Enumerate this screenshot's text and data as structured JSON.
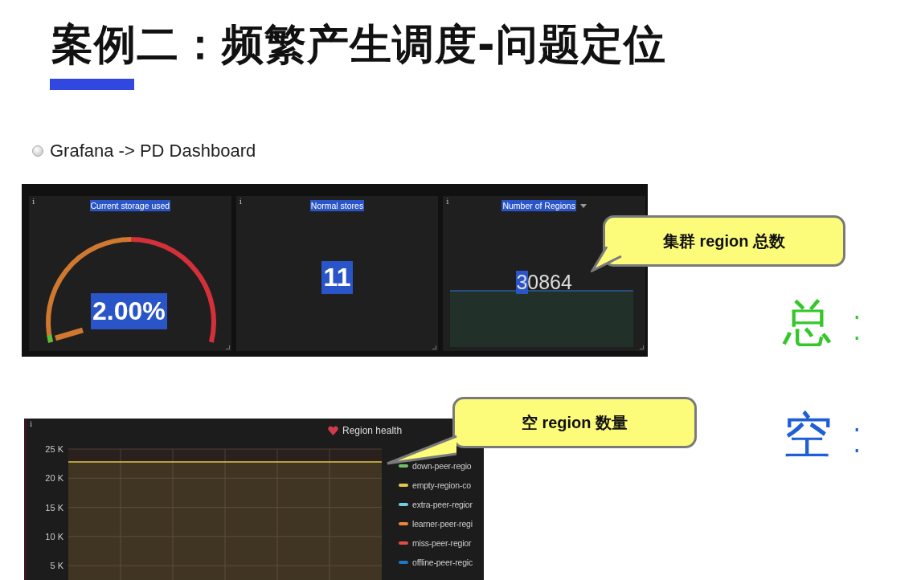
{
  "slide": {
    "title": "案例二：频繁产生调度-问题定位",
    "bullet": "Grafana -> PD Dashboard"
  },
  "stat_panels": [
    {
      "kind": "gauge",
      "info": "i",
      "title": "Current storage used",
      "value": "2.00%"
    },
    {
      "kind": "number",
      "info": "i",
      "title": "Normal stores",
      "value": "11"
    },
    {
      "kind": "sparkline",
      "info": "i",
      "title": "Number of Regions",
      "value": "30864",
      "dropdown": true
    }
  ],
  "graph_panel": {
    "info": "i",
    "title": "Region health",
    "legend": [
      {
        "name": "down-peer-regio",
        "color": "#73bf69"
      },
      {
        "name": "empty-region-co",
        "color": "#e5c84b"
      },
      {
        "name": "extra-peer-regior",
        "color": "#6ed0e0"
      },
      {
        "name": "learner-peer-regi",
        "color": "#ef843c"
      },
      {
        "name": "miss-peer-regior",
        "color": "#e24d42"
      },
      {
        "name": "offline-peer-regic",
        "color": "#1f78c1"
      }
    ],
    "chart_data": {
      "type": "area",
      "grid": true,
      "ylim": [
        0,
        25000
      ],
      "yticks": [
        {
          "value": 5000,
          "label": "5 K"
        },
        {
          "value": 10000,
          "label": "10 K"
        },
        {
          "value": 15000,
          "label": "15 K"
        },
        {
          "value": 20000,
          "label": "20 K"
        },
        {
          "value": 25000,
          "label": "25 K"
        }
      ],
      "series": [
        {
          "color": "#e5c84b",
          "values": [
            22800,
            22800,
            22800,
            22800,
            22800,
            22800,
            22800
          ]
        }
      ]
    }
  },
  "callouts": [
    "集群 region 总数",
    "空 region 数量"
  ],
  "handwriting": [
    {
      "text": "总 :",
      "color": "#35c72a"
    },
    {
      "text": "空 :",
      "color": "#1f5fd6"
    }
  ]
}
